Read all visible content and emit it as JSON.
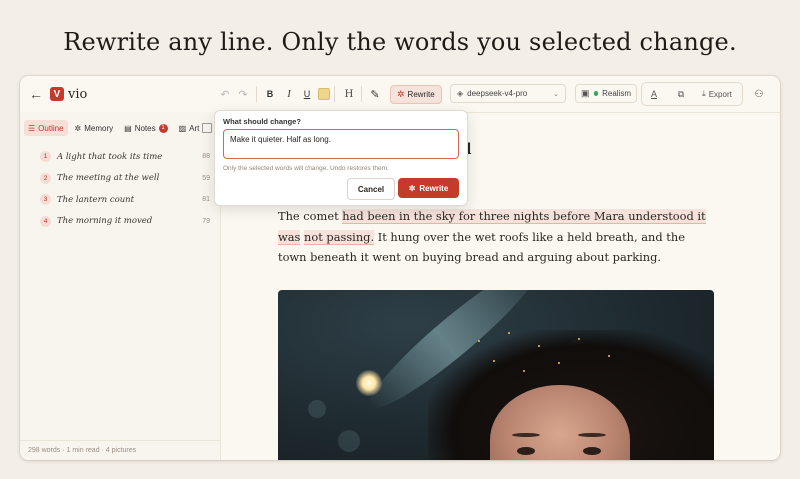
{
  "headline": "Rewrite any line. Only the words you selected change.",
  "app": {
    "name": "vio",
    "logo_letter": "V"
  },
  "toolbar": {
    "rewrite_label": "Rewrite",
    "model": "deepseek-v4-pro",
    "style_label": "Realism",
    "export_label": "Export",
    "heading_label": "H",
    "bold_label": "B",
    "italic_label": "I",
    "underline_label": "U"
  },
  "sidebar": {
    "tabs": [
      {
        "label": "Outline",
        "icon": "list-icon"
      },
      {
        "label": "Memory",
        "icon": "sparkle-icon"
      },
      {
        "label": "Notes",
        "icon": "note-icon",
        "badge": "1"
      },
      {
        "label": "Art",
        "icon": "image-icon"
      }
    ],
    "outline": [
      {
        "num": "1",
        "title": "A light that took its time",
        "count": "88"
      },
      {
        "num": "2",
        "title": "The meeting at the well",
        "count": "59"
      },
      {
        "num": "3",
        "title": "The lantern count",
        "count": "81"
      },
      {
        "num": "4",
        "title": "The morning it moved",
        "count": "79"
      }
    ],
    "footer": "298 words · 1 min read · 4 pictures"
  },
  "editor": {
    "title_fragment": "d",
    "paragraph": {
      "before": "The comet ",
      "selected_1": "had been in the sky for three nights before Mara understood it was",
      "selected_2": "not passing.",
      "after": " It hung over the wet roofs like a held breath, and the town beneath it went on buying bread and arguing about parking."
    }
  },
  "popover": {
    "label": "What should change?",
    "input_value": "Make it quieter. Half as long.",
    "hint": "Only the selected words will change. Undo restores them.",
    "cancel_label": "Cancel",
    "rewrite_label": "Rewrite"
  },
  "colors": {
    "accent": "#c63a2b",
    "status_dot": "#3aa35a"
  }
}
